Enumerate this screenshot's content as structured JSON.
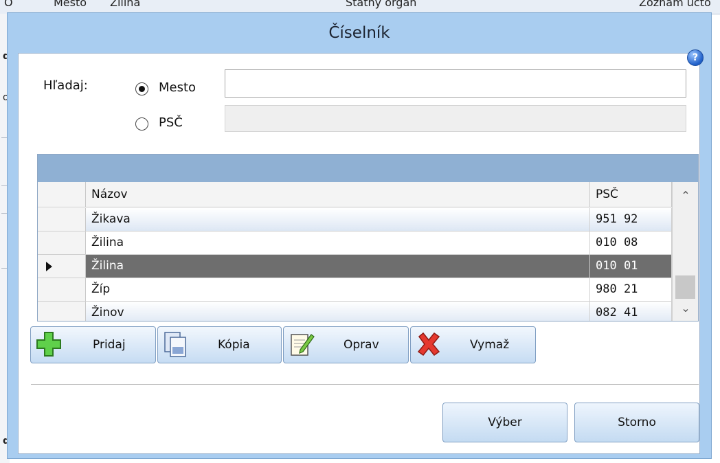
{
  "background": {
    "top_fragments": [
      "O",
      "Mesto",
      "Žilina",
      "Štatný orgán",
      "Zoznam účto"
    ],
    "left_fragments": [
      "d",
      "o",
      "d"
    ]
  },
  "dialog": {
    "title": "Číselník",
    "help_glyph": "?",
    "search": {
      "label": "Hľadaj:",
      "option_mesto": "Mesto",
      "option_psc": "PSČ",
      "selected": "Mesto",
      "mesto_value": "",
      "psc_value": ""
    },
    "grid": {
      "columns": [
        "Názov",
        "PSČ"
      ],
      "rows": [
        {
          "name": "Žikava",
          "psc": "951 92",
          "selected": false
        },
        {
          "name": "Žilina",
          "psc": "010 08",
          "selected": false
        },
        {
          "name": "Žilina",
          "psc": "010 01",
          "selected": true
        },
        {
          "name": "Žíp",
          "psc": "980 21",
          "selected": false
        },
        {
          "name": "Žinov",
          "psc": "082 41",
          "selected": false
        }
      ]
    },
    "actions": {
      "add": "Pridaj",
      "copy": "Kópia",
      "edit": "Oprav",
      "delete": "Vymaž"
    },
    "footer": {
      "select": "Výber",
      "cancel": "Storno"
    },
    "icons": {
      "add": "plus-icon",
      "copy": "copy-icon",
      "edit": "edit-icon",
      "delete": "delete-x-icon",
      "help": "help-icon"
    },
    "colors": {
      "title_band": "#a9cdf0",
      "grid_band": "#8fb0d3",
      "selected_row": "#6e6e6e"
    }
  }
}
